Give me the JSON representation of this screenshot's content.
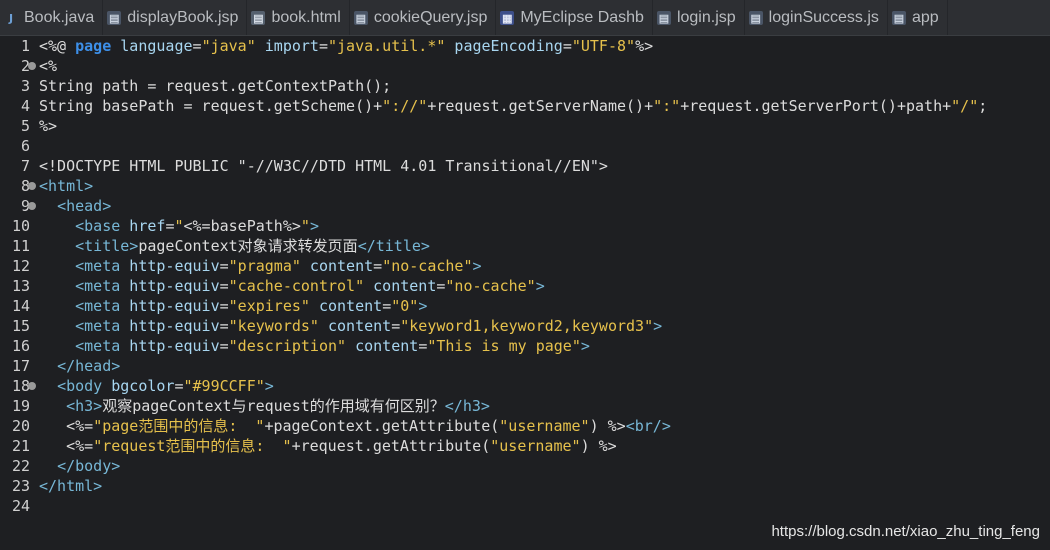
{
  "tabs": [
    {
      "label": "Book.java",
      "icon": "java-file-icon"
    },
    {
      "label": "displayBook.jsp",
      "icon": "jsp-file-icon"
    },
    {
      "label": "book.html",
      "icon": "html-file-icon"
    },
    {
      "label": "cookieQuery.jsp",
      "icon": "jsp-file-icon"
    },
    {
      "label": "MyEclipse Dashb",
      "icon": "dashboard-icon"
    },
    {
      "label": "login.jsp",
      "icon": "jsp-file-icon"
    },
    {
      "label": "loginSuccess.js",
      "icon": "js-file-icon"
    },
    {
      "label": "app",
      "icon": "jsp-file-icon"
    }
  ],
  "lines": [
    {
      "n": "1",
      "fold": false,
      "segs": [
        [
          "plain",
          "<%@ "
        ],
        [
          "kw",
          "page"
        ],
        [
          "attr",
          " language"
        ],
        [
          "plain",
          "="
        ],
        [
          "str",
          "\"java\""
        ],
        [
          "attr",
          " import"
        ],
        [
          "plain",
          "="
        ],
        [
          "str",
          "\"java.util.*\""
        ],
        [
          "attr",
          " pageEncoding"
        ],
        [
          "plain",
          "="
        ],
        [
          "str",
          "\"UTF-8\""
        ],
        [
          "plain",
          "%>"
        ]
      ]
    },
    {
      "n": "2",
      "fold": true,
      "segs": [
        [
          "plain",
          "<%"
        ]
      ]
    },
    {
      "n": "3",
      "fold": false,
      "segs": [
        [
          "plain",
          "String path = request.getContextPath();"
        ]
      ]
    },
    {
      "n": "4",
      "fold": false,
      "segs": [
        [
          "plain",
          "String basePath = request.getScheme()+"
        ],
        [
          "str",
          "\"://\""
        ],
        [
          "plain",
          "+request.getServerName()+"
        ],
        [
          "str",
          "\":\""
        ],
        [
          "plain",
          "+request.getServerPort()+path+"
        ],
        [
          "str",
          "\"/\""
        ],
        [
          "plain",
          ";"
        ]
      ]
    },
    {
      "n": "5",
      "fold": false,
      "segs": [
        [
          "plain",
          "%>"
        ]
      ]
    },
    {
      "n": "6",
      "fold": false,
      "segs": [
        [
          "plain",
          ""
        ]
      ]
    },
    {
      "n": "7",
      "fold": false,
      "segs": [
        [
          "plain",
          "<!DOCTYPE HTML PUBLIC \"-//W3C//DTD HTML 4.01 Transitional//EN\">"
        ]
      ]
    },
    {
      "n": "8",
      "fold": true,
      "segs": [
        [
          "tag",
          "<html>"
        ]
      ]
    },
    {
      "n": "9",
      "fold": true,
      "segs": [
        [
          "plain",
          "  "
        ],
        [
          "tag",
          "<head>"
        ]
      ]
    },
    {
      "n": "10",
      "fold": false,
      "segs": [
        [
          "plain",
          "    "
        ],
        [
          "tag",
          "<base"
        ],
        [
          "attr",
          " href"
        ],
        [
          "plain",
          "="
        ],
        [
          "str",
          "\""
        ],
        [
          "plain",
          "<%=basePath%>"
        ],
        [
          "str",
          "\""
        ],
        [
          "tag",
          ">"
        ]
      ]
    },
    {
      "n": "11",
      "fold": false,
      "segs": [
        [
          "plain",
          "    "
        ],
        [
          "tag",
          "<title>"
        ],
        [
          "plain",
          "pageContext对象请求转发页面"
        ],
        [
          "tag",
          "</title>"
        ]
      ]
    },
    {
      "n": "12",
      "fold": false,
      "segs": [
        [
          "plain",
          "    "
        ],
        [
          "tag",
          "<meta"
        ],
        [
          "attr",
          " http-equiv"
        ],
        [
          "plain",
          "="
        ],
        [
          "str",
          "\"pragma\""
        ],
        [
          "attr",
          " content"
        ],
        [
          "plain",
          "="
        ],
        [
          "str",
          "\"no-cache\""
        ],
        [
          "tag",
          ">"
        ]
      ]
    },
    {
      "n": "13",
      "fold": false,
      "segs": [
        [
          "plain",
          "    "
        ],
        [
          "tag",
          "<meta"
        ],
        [
          "attr",
          " http-equiv"
        ],
        [
          "plain",
          "="
        ],
        [
          "str",
          "\"cache-control\""
        ],
        [
          "attr",
          " content"
        ],
        [
          "plain",
          "="
        ],
        [
          "str",
          "\"no-cache\""
        ],
        [
          "tag",
          ">"
        ]
      ]
    },
    {
      "n": "14",
      "fold": false,
      "segs": [
        [
          "plain",
          "    "
        ],
        [
          "tag",
          "<meta"
        ],
        [
          "attr",
          " http-equiv"
        ],
        [
          "plain",
          "="
        ],
        [
          "str",
          "\"expires\""
        ],
        [
          "attr",
          " content"
        ],
        [
          "plain",
          "="
        ],
        [
          "str",
          "\"0\""
        ],
        [
          "tag",
          ">"
        ]
      ]
    },
    {
      "n": "15",
      "fold": false,
      "segs": [
        [
          "plain",
          "    "
        ],
        [
          "tag",
          "<meta"
        ],
        [
          "attr",
          " http-equiv"
        ],
        [
          "plain",
          "="
        ],
        [
          "str",
          "\"keywords\""
        ],
        [
          "attr",
          " content"
        ],
        [
          "plain",
          "="
        ],
        [
          "str",
          "\"keyword1,keyword2,keyword3\""
        ],
        [
          "tag",
          ">"
        ]
      ]
    },
    {
      "n": "16",
      "fold": false,
      "segs": [
        [
          "plain",
          "    "
        ],
        [
          "tag",
          "<meta"
        ],
        [
          "attr",
          " http-equiv"
        ],
        [
          "plain",
          "="
        ],
        [
          "str",
          "\"description\""
        ],
        [
          "attr",
          " content"
        ],
        [
          "plain",
          "="
        ],
        [
          "str",
          "\"This is my page\""
        ],
        [
          "tag",
          ">"
        ]
      ]
    },
    {
      "n": "17",
      "fold": false,
      "segs": [
        [
          "plain",
          "  "
        ],
        [
          "tag",
          "</head>"
        ]
      ]
    },
    {
      "n": "18",
      "fold": true,
      "segs": [
        [
          "plain",
          "  "
        ],
        [
          "tag",
          "<body"
        ],
        [
          "attr",
          " bgcolor"
        ],
        [
          "plain",
          "="
        ],
        [
          "str",
          "\"#99CCFF\""
        ],
        [
          "tag",
          ">"
        ]
      ]
    },
    {
      "n": "19",
      "fold": false,
      "segs": [
        [
          "plain",
          "   "
        ],
        [
          "tag",
          "<h3>"
        ],
        [
          "plain",
          "观察pageContext与request的作用域有何区别？"
        ],
        [
          "tag",
          "</h3>"
        ]
      ]
    },
    {
      "n": "20",
      "fold": false,
      "segs": [
        [
          "plain",
          "   <%="
        ],
        [
          "str",
          "\"page范围中的信息:  \""
        ],
        [
          "plain",
          "+pageContext.getAttribute("
        ],
        [
          "str",
          "\"username\""
        ],
        [
          "plain",
          ") %>"
        ],
        [
          "tag",
          "<br/>"
        ]
      ]
    },
    {
      "n": "21",
      "fold": false,
      "segs": [
        [
          "plain",
          "   <%="
        ],
        [
          "str",
          "\"request范围中的信息:  \""
        ],
        [
          "plain",
          "+request.getAttribute("
        ],
        [
          "str",
          "\"username\""
        ],
        [
          "plain",
          ") %>"
        ]
      ]
    },
    {
      "n": "22",
      "fold": false,
      "segs": [
        [
          "plain",
          "  "
        ],
        [
          "tag",
          "</body>"
        ]
      ]
    },
    {
      "n": "23",
      "fold": false,
      "segs": [
        [
          "tag",
          "</html>"
        ]
      ]
    },
    {
      "n": "24",
      "fold": false,
      "segs": [
        [
          "plain",
          ""
        ]
      ]
    }
  ],
  "watermark": "https://blog.csdn.net/xiao_zhu_ting_feng",
  "colors": {
    "background": "#1e1f22",
    "tag": "#77b7d6",
    "attribute": "#a8d6f0",
    "string": "#e6c14c",
    "keyword": "#3d8fe8",
    "text": "#dcdcdc"
  }
}
